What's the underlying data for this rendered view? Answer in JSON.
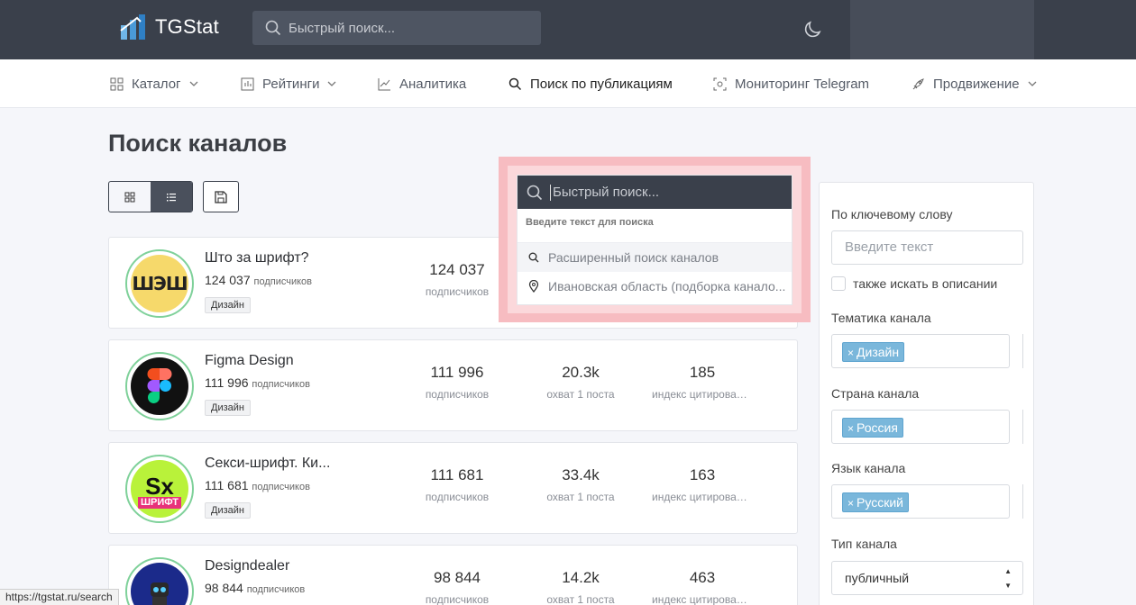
{
  "header": {
    "logo_text": "TGStat",
    "search_placeholder": "Быстрый поиск..."
  },
  "nav": {
    "items": [
      {
        "label": "Каталог",
        "icon": "grid-icon",
        "dropdown": true
      },
      {
        "label": "Рейтинги",
        "icon": "chart-bar-icon",
        "dropdown": true
      },
      {
        "label": "Аналитика",
        "icon": "line-chart-icon",
        "dropdown": false
      },
      {
        "label": "Поиск по публикациям",
        "icon": "search-icon",
        "dropdown": false
      },
      {
        "label": "Мониторинг Telegram",
        "icon": "monitor-icon",
        "dropdown": false
      },
      {
        "label": "Продвижение",
        "icon": "rocket-icon",
        "dropdown": true
      }
    ]
  },
  "page": {
    "title": "Поиск каналов"
  },
  "search_dropdown": {
    "placeholder": "Быстрый поиск...",
    "hint": "Введите текст для поиска",
    "items": [
      {
        "label": "Расширенный поиск каналов",
        "icon": "search-icon"
      },
      {
        "label": "Ивановская область (подборка канало...",
        "icon": "map-pin-icon"
      }
    ]
  },
  "channels": [
    {
      "name": "Што за шрифт?",
      "subs": "124 037",
      "subs_unit": "подписчиков",
      "tag": "Дизайн",
      "stats": [
        {
          "value": "124 037",
          "label": "подписчиков"
        }
      ]
    },
    {
      "name": "Figma Design",
      "subs": "111 996",
      "subs_unit": "подписчиков",
      "tag": "Дизайн",
      "stats": [
        {
          "value": "111 996",
          "label": "подписчиков"
        },
        {
          "value": "20.3k",
          "label": "охват 1 поста"
        },
        {
          "value": "185",
          "label": "индекс цитирования"
        }
      ]
    },
    {
      "name": "Секси-шрифт. Ки...",
      "subs": "111 681",
      "subs_unit": "подписчиков",
      "tag": "Дизайн",
      "stats": [
        {
          "value": "111 681",
          "label": "подписчиков"
        },
        {
          "value": "33.4k",
          "label": "охват 1 поста"
        },
        {
          "value": "163",
          "label": "индекс цитирования"
        }
      ]
    },
    {
      "name": "Designdealer",
      "subs": "98 844",
      "subs_unit": "подписчиков",
      "tag": "",
      "stats": [
        {
          "value": "98 844",
          "label": "подписчиков"
        },
        {
          "value": "14.2k",
          "label": "охват 1 поста"
        },
        {
          "value": "463",
          "label": "индекс цитирования"
        }
      ]
    }
  ],
  "filters": {
    "keyword_label": "По ключевому слову",
    "keyword_placeholder": "Введите текст",
    "desc_checkbox_label": "также искать в описании",
    "topic_label": "Тематика канала",
    "topic_value": "Дизайн",
    "country_label": "Страна канала",
    "country_value": "Россия",
    "language_label": "Язык канала",
    "language_value": "Русский",
    "type_label": "Тип канала",
    "type_value": "публичный"
  },
  "statusbar": {
    "url": "https://tgstat.ru/search"
  }
}
